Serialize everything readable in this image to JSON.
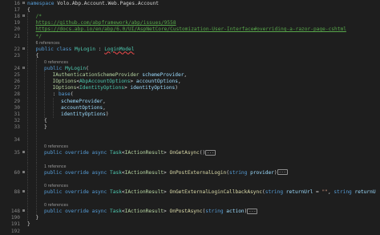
{
  "editor": {
    "lines": [
      {
        "n": "16",
        "fold": "⊟",
        "indent": 0,
        "ref": false,
        "tokens": [
          [
            "kw",
            "namespace "
          ],
          [
            "id",
            "Volo.Abp.Account.Web.Pages.Account"
          ]
        ]
      },
      {
        "n": "17",
        "fold": "",
        "indent": 0,
        "ref": false,
        "tokens": [
          [
            "id",
            "{"
          ]
        ]
      },
      {
        "n": "18",
        "fold": "⊟",
        "indent": 1,
        "ref": false,
        "tokens": [
          [
            "cm",
            "/*"
          ]
        ]
      },
      {
        "n": "19",
        "fold": "",
        "indent": 1,
        "ref": false,
        "tokens": [
          [
            "url",
            "https://github.com/abpframework/abp/issues/9558"
          ]
        ]
      },
      {
        "n": "20",
        "fold": "",
        "indent": 1,
        "ref": false,
        "tokens": [
          [
            "url",
            "https://docs.abp.io/en/abp/6.0/UI/AspNetCore/Customization-User-Interface#overriding-a-razor-page-cshtml"
          ]
        ]
      },
      {
        "n": "21",
        "fold": "",
        "indent": 1,
        "ref": false,
        "tokens": [
          [
            "cm",
            "*/"
          ]
        ]
      },
      {
        "n": "",
        "fold": "",
        "indent": 1,
        "ref": true,
        "tokens": [
          [
            "ref",
            "6 references"
          ]
        ]
      },
      {
        "n": "22",
        "fold": "⊟",
        "indent": 1,
        "ref": false,
        "tokens": [
          [
            "kw",
            "public class "
          ],
          [
            "ty",
            "MyLogin"
          ],
          [
            "id",
            " : "
          ],
          [
            "ty",
            "LoginModel"
          ]
        ]
      },
      {
        "n": "23",
        "fold": "",
        "indent": 1,
        "ref": false,
        "tokens": [
          [
            "id",
            "{"
          ]
        ]
      },
      {
        "n": "",
        "fold": "",
        "indent": 2,
        "ref": true,
        "tokens": [
          [
            "ref",
            "0 references"
          ]
        ]
      },
      {
        "n": "24",
        "fold": "⊟",
        "indent": 2,
        "ref": false,
        "tokens": [
          [
            "kw",
            "public "
          ],
          [
            "ty",
            "MyLogin"
          ],
          [
            "id",
            "("
          ]
        ]
      },
      {
        "n": "25",
        "fold": "",
        "indent": 3,
        "ref": false,
        "tokens": [
          [
            "ty2",
            "IAuthenticationSchemeProvider"
          ],
          [
            "id",
            " "
          ],
          [
            "pm",
            "schemeProvider"
          ],
          [
            "id",
            ","
          ]
        ]
      },
      {
        "n": "26",
        "fold": "",
        "indent": 3,
        "ref": false,
        "tokens": [
          [
            "ty2",
            "IOptions"
          ],
          [
            "id",
            "<"
          ],
          [
            "ty",
            "AbpAccountOptions"
          ],
          [
            "id",
            "> "
          ],
          [
            "pm",
            "accountOptions"
          ],
          [
            "id",
            ","
          ]
        ]
      },
      {
        "n": "27",
        "fold": "",
        "indent": 3,
        "ref": false,
        "tokens": [
          [
            "ty2",
            "IOptions"
          ],
          [
            "id",
            "<"
          ],
          [
            "ty",
            "IdentityOptions"
          ],
          [
            "id",
            "> "
          ],
          [
            "pm",
            "identityOptions"
          ],
          [
            "id",
            ")"
          ]
        ]
      },
      {
        "n": "28",
        "fold": "",
        "indent": 3,
        "ref": false,
        "tokens": [
          [
            "id",
            ": "
          ],
          [
            "kw",
            "base"
          ],
          [
            "id",
            "("
          ]
        ]
      },
      {
        "n": "29",
        "fold": "",
        "indent": 4,
        "ref": false,
        "tokens": [
          [
            "pm",
            "schemeProvider"
          ],
          [
            "id",
            ","
          ]
        ]
      },
      {
        "n": "30",
        "fold": "",
        "indent": 4,
        "ref": false,
        "tokens": [
          [
            "pm",
            "accountOptions"
          ],
          [
            "id",
            ","
          ]
        ]
      },
      {
        "n": "31",
        "fold": "",
        "indent": 4,
        "ref": false,
        "tokens": [
          [
            "pm",
            "identityOptions"
          ],
          [
            "id",
            ")"
          ]
        ]
      },
      {
        "n": "32",
        "fold": "",
        "indent": 2,
        "ref": false,
        "tokens": [
          [
            "id",
            "{"
          ]
        ]
      },
      {
        "n": "33",
        "fold": "",
        "indent": 2,
        "ref": false,
        "tokens": [
          [
            "id",
            "}"
          ]
        ]
      },
      {
        "n": "",
        "fold": "",
        "indent": 2,
        "ref": false,
        "tokens": []
      },
      {
        "n": "34",
        "fold": "",
        "indent": 2,
        "ref": false,
        "tokens": []
      },
      {
        "n": "",
        "fold": "",
        "indent": 2,
        "ref": true,
        "tokens": [
          [
            "ref",
            "0 references"
          ]
        ]
      },
      {
        "n": "35",
        "fold": "⊞",
        "indent": 2,
        "ref": false,
        "tokens": [
          [
            "kw",
            "public override async "
          ],
          [
            "ty",
            "Task"
          ],
          [
            "id",
            "<"
          ],
          [
            "ty2",
            "IActionResult"
          ],
          [
            "id",
            "> "
          ],
          [
            "mt",
            "OnGetAsync"
          ],
          [
            "id",
            "()"
          ],
          [
            "box",
            "..."
          ]
        ]
      },
      {
        "n": "",
        "fold": "",
        "indent": 2,
        "ref": false,
        "tokens": []
      },
      {
        "n": "",
        "fold": "",
        "indent": 2,
        "ref": true,
        "tokens": [
          [
            "ref",
            "1 reference"
          ]
        ]
      },
      {
        "n": "60",
        "fold": "⊞",
        "indent": 2,
        "ref": false,
        "tokens": [
          [
            "kw",
            "public override async "
          ],
          [
            "ty",
            "Task"
          ],
          [
            "id",
            "<"
          ],
          [
            "ty2",
            "IActionResult"
          ],
          [
            "id",
            "> "
          ],
          [
            "mt",
            "OnPostExternalLogin"
          ],
          [
            "id",
            "("
          ],
          [
            "kw",
            "string "
          ],
          [
            "pm",
            "provider"
          ],
          [
            "id",
            ")"
          ],
          [
            "box",
            "..."
          ]
        ]
      },
      {
        "n": "",
        "fold": "",
        "indent": 2,
        "ref": false,
        "tokens": []
      },
      {
        "n": "",
        "fold": "",
        "indent": 2,
        "ref": true,
        "tokens": [
          [
            "ref",
            "0 references"
          ]
        ]
      },
      {
        "n": "88",
        "fold": "⊞",
        "indent": 2,
        "ref": false,
        "tokens": [
          [
            "kw",
            "public override async "
          ],
          [
            "ty",
            "Task"
          ],
          [
            "id",
            "<"
          ],
          [
            "ty2",
            "IActionResult"
          ],
          [
            "id",
            "> "
          ],
          [
            "mt",
            "OnGetExternalLoginCallbackAsync"
          ],
          [
            "id",
            "("
          ],
          [
            "kw",
            "string "
          ],
          [
            "pm",
            "returnUrl"
          ],
          [
            "id",
            " = "
          ],
          [
            "st",
            "\"\""
          ],
          [
            "id",
            ", "
          ],
          [
            "kw",
            "string "
          ],
          [
            "pm",
            "returnU"
          ]
        ]
      },
      {
        "n": "",
        "fold": "",
        "indent": 2,
        "ref": false,
        "tokens": []
      },
      {
        "n": "",
        "fold": "",
        "indent": 2,
        "ref": true,
        "tokens": [
          [
            "ref",
            "0 references"
          ]
        ]
      },
      {
        "n": "148",
        "fold": "⊞",
        "indent": 2,
        "ref": false,
        "tokens": [
          [
            "kw",
            "public override async "
          ],
          [
            "ty",
            "Task"
          ],
          [
            "id",
            "<"
          ],
          [
            "ty2",
            "IActionResult"
          ],
          [
            "id",
            "> "
          ],
          [
            "mt",
            "OnPostAsync"
          ],
          [
            "id",
            "("
          ],
          [
            "kw",
            "string "
          ],
          [
            "pm",
            "action"
          ],
          [
            "id",
            ")"
          ],
          [
            "box",
            "..."
          ]
        ]
      },
      {
        "n": "190",
        "fold": "",
        "indent": 1,
        "ref": false,
        "tokens": [
          [
            "id",
            "}"
          ]
        ]
      },
      {
        "n": "191",
        "fold": "",
        "indent": 0,
        "ref": false,
        "tokens": [
          [
            "id",
            "}"
          ]
        ]
      },
      {
        "n": "192",
        "fold": "",
        "indent": 0,
        "ref": false,
        "tokens": []
      }
    ]
  }
}
